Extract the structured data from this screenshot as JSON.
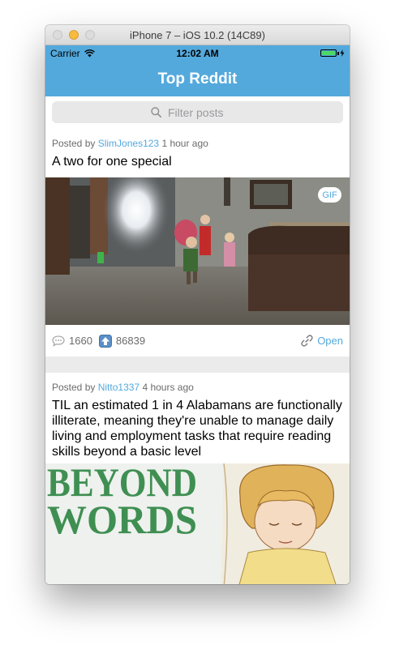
{
  "window": {
    "title": "iPhone 7 – iOS 10.2 (14C89)"
  },
  "status_bar": {
    "carrier": "Carrier",
    "time": "12:02 AM"
  },
  "nav": {
    "title": "Top Reddit"
  },
  "search": {
    "placeholder": "Filter posts"
  },
  "posts": [
    {
      "posted_by_prefix": "Posted by",
      "author": "SlimJones123",
      "time_ago": "1 hour ago",
      "title": "A two for one special",
      "badge": "GIF",
      "comments": "1660",
      "upvotes": "86839",
      "open_label": "Open"
    },
    {
      "posted_by_prefix": "Posted by",
      "author": "Nitto1337",
      "time_ago": "4 hours ago",
      "title": "TIL an estimated 1 in 4 Alabamans are functionally illiterate, meaning they're unable to manage daily living and employment tasks that require reading skills beyond a basic level",
      "image_text": "BEYOND WORDS"
    }
  ],
  "colors": {
    "accent": "#54a9dc",
    "battery": "#4cd964",
    "separator": "#ebebeb",
    "book_green": "#3f8f52"
  }
}
